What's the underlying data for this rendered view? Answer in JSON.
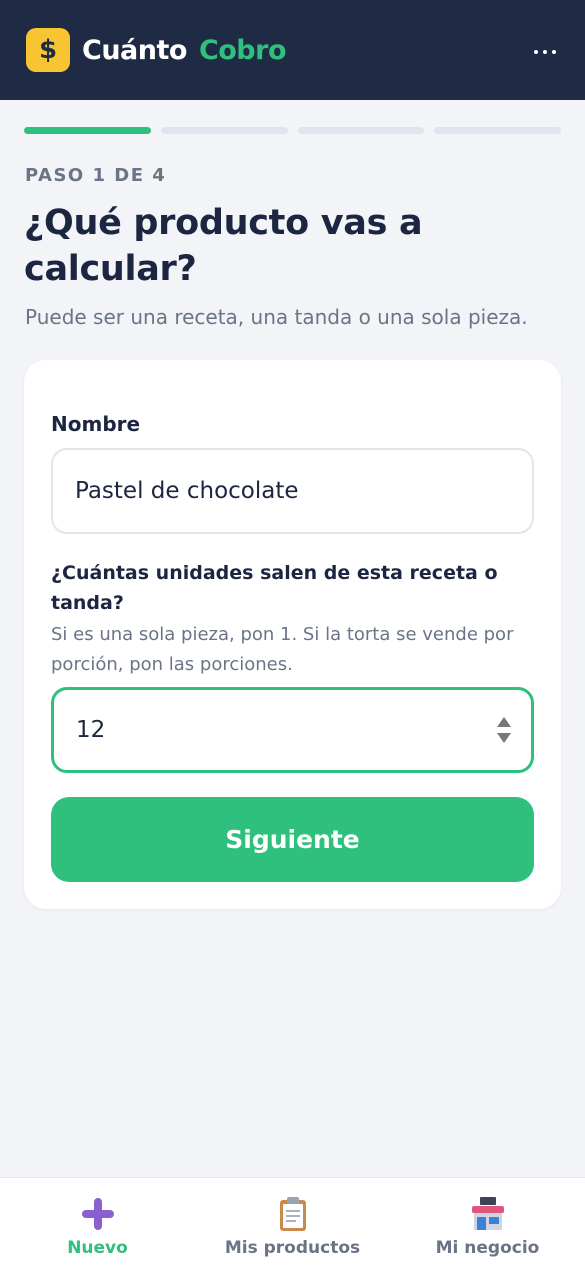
{
  "header": {
    "logo_symbol": "$",
    "brand_part1": "Cuánto",
    "brand_part2": "Cobro",
    "menu_icon": "more-horizontal-icon"
  },
  "progress": {
    "current_step": 1,
    "total_steps": 4
  },
  "step": {
    "label": "PASO 1 DE 4",
    "title": "¿Qué producto vas a calcular?",
    "subtitle": "Puede ser una receta, una tanda o una sola pieza."
  },
  "form": {
    "name_label": "Nombre",
    "name_value": "Pastel de chocolate",
    "units_label": "¿Cuántas unidades salen de esta receta o tanda?",
    "units_help": "Si es una sola pieza, pon 1. Si la torta se vende por porción, pon las porciones.",
    "units_value": "12",
    "next_label": "Siguiente"
  },
  "nav": {
    "items": [
      {
        "label": "Nuevo",
        "icon": "plus-icon",
        "active": true
      },
      {
        "label": "Mis productos",
        "icon": "clipboard-icon",
        "active": false
      },
      {
        "label": "Mi negocio",
        "icon": "store-icon",
        "active": false
      }
    ]
  },
  "colors": {
    "header_bg": "#1f2a44",
    "accent": "#2fc07d",
    "logo_bg": "#f7c531",
    "page_bg": "#f3f4f8"
  }
}
